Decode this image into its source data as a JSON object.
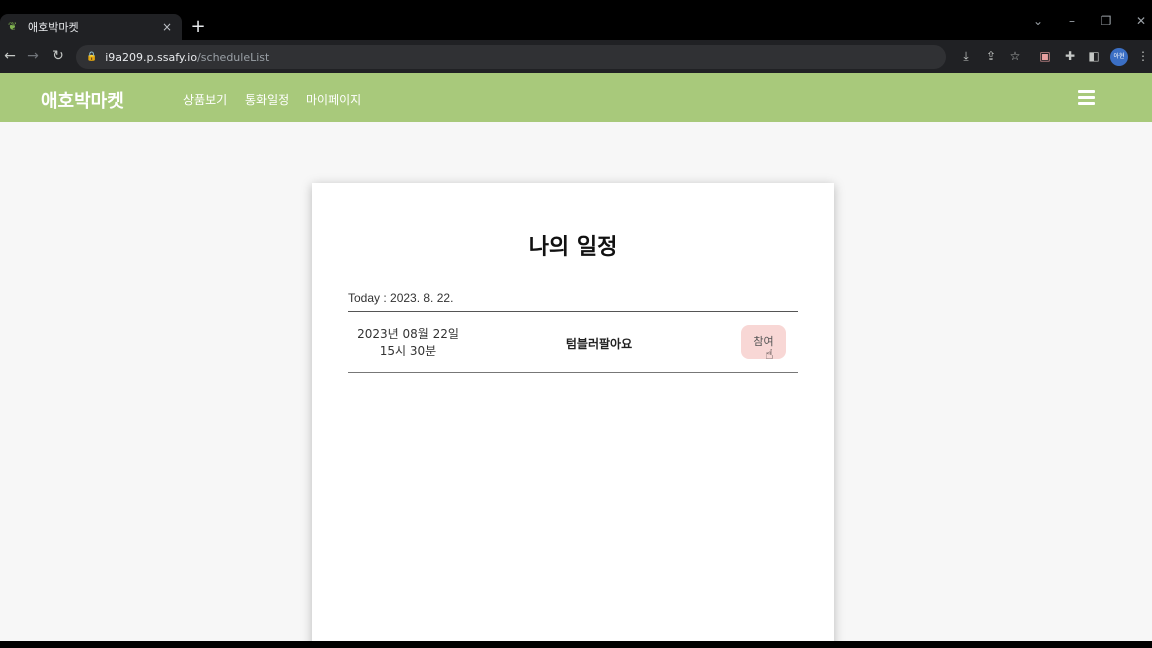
{
  "browser": {
    "tab_title": "애호박마켓",
    "tab_close": "×",
    "new_tab": "+",
    "url_host": "i9a209.p.ssafy.io",
    "url_path": "/scheduleList",
    "profile": "아현"
  },
  "nav": {
    "brand": "애호박마켓",
    "links": [
      "상품보기",
      "통화일정",
      "마이페이지"
    ]
  },
  "card": {
    "title": "나의 일정",
    "today_label": "Today : 2023. 8. 22.",
    "schedules": [
      {
        "date": "2023년 08월 22일",
        "time": "15시 30분",
        "title": "텀블러팔아요",
        "action": "참여"
      }
    ]
  },
  "colors": {
    "nav_bg": "#a8c97b",
    "join_button_bg": "#f8d7d5"
  }
}
